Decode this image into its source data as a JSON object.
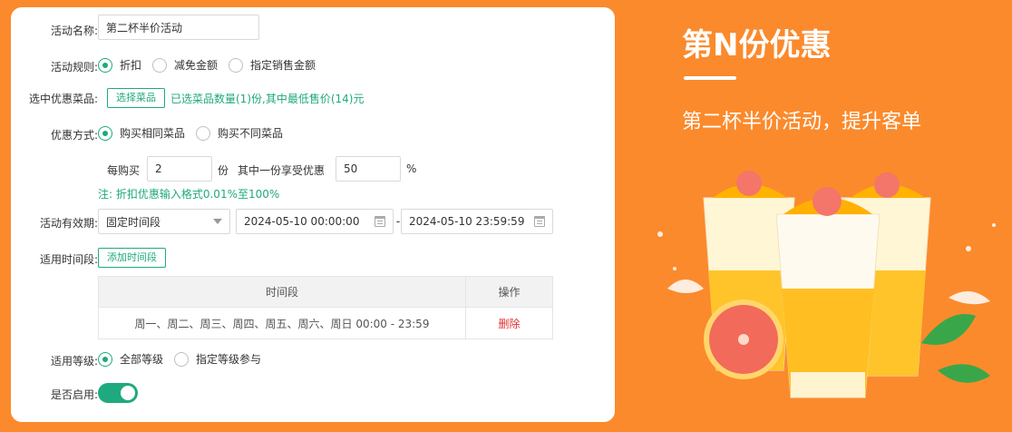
{
  "form": {
    "activity_name_label": "活动名称:",
    "activity_name_value": "第二杯半价活动",
    "rule_label": "活动规则:",
    "rule_options": [
      "折扣",
      "减免金额",
      "指定销售金额"
    ],
    "dish_label": "选中优惠菜品:",
    "select_dish_button": "选择菜品",
    "selected_info": "已选菜品数量(1)份,其中最低售价(14)元",
    "method_label": "优惠方式:",
    "method_options": [
      "购买相同菜品",
      "购买不同菜品"
    ],
    "per_buy_label": "每购买",
    "per_buy_value": "2",
    "unit_label": "份",
    "one_discount_label": "其中一份享受优惠",
    "discount_value": "50",
    "percent_sign": "%",
    "note": "注: 折扣优惠输入格式0.01%至100%",
    "validity_label": "活动有效期:",
    "validity_type": "固定时间段",
    "start_date": "2024-05-10 00:00:00",
    "range_separator": "-",
    "end_date": "2024-05-10 23:59:59",
    "time_slot_label": "适用时间段:",
    "add_time_slot_button": "添加时间段",
    "table_headers": [
      "时间段",
      "操作"
    ],
    "table_rows": [
      {
        "slot": "周一、周二、周三、周四、周五、周六、周日 00:00 - 23:59",
        "action": "删除"
      }
    ],
    "level_label": "适用等级:",
    "level_options": [
      "全部等级",
      "指定等级参与"
    ],
    "enable_label": "是否启用:",
    "enabled": true
  },
  "promo": {
    "title": "第N份优惠",
    "subtitle": "第二杯半价活动，提升客单"
  },
  "colors": {
    "accent_green": "#1fa97e",
    "background_orange": "#FB8A2C",
    "delete_red": "#e03030"
  }
}
